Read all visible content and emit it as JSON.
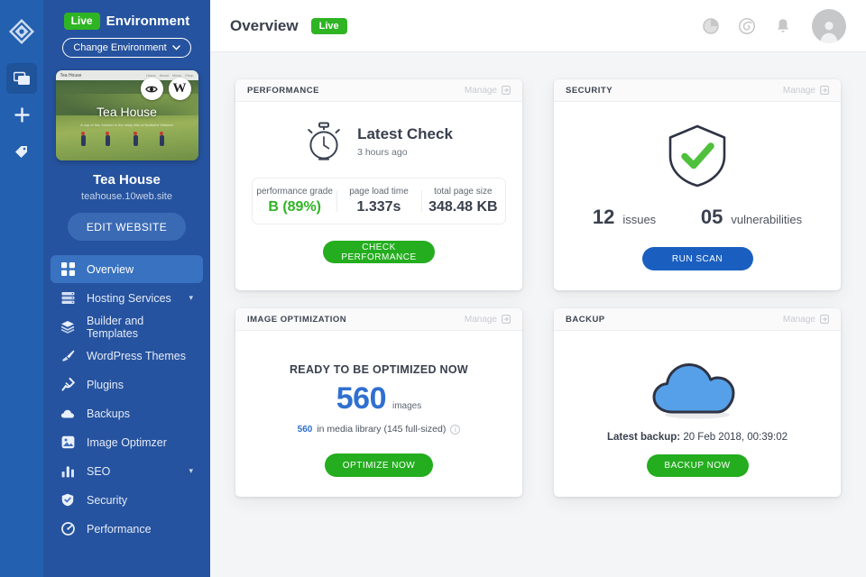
{
  "rail": {
    "logo": "diamond-logo",
    "items": [
      {
        "name": "websites-icon",
        "active": true
      },
      {
        "name": "add-icon",
        "active": false
      },
      {
        "name": "tag-icon",
        "active": false
      }
    ]
  },
  "sidebar": {
    "env_badge": "Live",
    "env_label": "Environment",
    "change_env": "Change Environment",
    "thumbnail": {
      "site_label": "Tea House",
      "hero_title": "Tea House",
      "hero_sub": "A cup of tea, brewed in the misty hills of Northern Vietnam",
      "nav": [
        "Home",
        "About",
        "Menu",
        "Shop"
      ],
      "preview_icon": "eye-icon",
      "wordpress_icon": "wordpress-icon"
    },
    "site_name": "Tea House",
    "site_url": "teahouse.10web.site",
    "edit_button": "EDIT WEBSITE",
    "items": [
      {
        "label": "Overview",
        "icon": "grid-icon",
        "active": true,
        "caret": false
      },
      {
        "label": "Hosting Services",
        "icon": "server-icon",
        "active": false,
        "caret": true
      },
      {
        "label": "Builder and Templates",
        "icon": "layers-icon",
        "active": false,
        "caret": false
      },
      {
        "label": "WordPress Themes",
        "icon": "brush-icon",
        "active": false,
        "caret": false
      },
      {
        "label": "Plugins",
        "icon": "plug-icon",
        "active": false,
        "caret": false
      },
      {
        "label": "Backups",
        "icon": "cloud-icon",
        "active": false,
        "caret": false
      },
      {
        "label": "Image Optimzer",
        "icon": "image-icon",
        "active": false,
        "caret": false
      },
      {
        "label": "SEO",
        "icon": "bar-chart-icon",
        "active": false,
        "caret": true
      },
      {
        "label": "Security",
        "icon": "shield-icon",
        "active": false,
        "caret": false
      },
      {
        "label": "Performance",
        "icon": "gauge-icon",
        "active": false,
        "caret": false
      }
    ]
  },
  "topbar": {
    "title": "Overview",
    "badge": "Live",
    "icons": [
      "pie-chart-icon",
      "spiral-icon",
      "bell-icon"
    ],
    "avatar": "user-avatar"
  },
  "cards": {
    "performance": {
      "head": "PERFORMANCE",
      "manage": "Manage",
      "icon": "stopwatch-icon",
      "heading": "Latest Check",
      "subtitle": "3 hours ago",
      "metrics": [
        {
          "label": "performance grade",
          "value": "B (89%)",
          "accent": true
        },
        {
          "label": "page load time",
          "value": "1.337s",
          "accent": false
        },
        {
          "label": "total page size",
          "value": "348.48 KB",
          "accent": false
        }
      ],
      "button": "CHECK PERFORMANCE"
    },
    "security": {
      "head": "SECURITY",
      "manage": "Manage",
      "icon": "shield-check-icon",
      "stats": [
        {
          "number": "12",
          "word": "issues"
        },
        {
          "number": "05",
          "word": "vulnerabilities"
        }
      ],
      "button": "RUN SCAN"
    },
    "image_optimization": {
      "head": "IMAGE OPTIMIZATION",
      "manage": "Manage",
      "title": "READY TO BE OPTIMIZED NOW",
      "count": "560",
      "unit": "images",
      "note_count": "560",
      "note_text": "in media library (145 full-sized)",
      "info_icon": "info-icon",
      "button": "OPTIMIZE NOW"
    },
    "backup": {
      "head": "BACKUP",
      "manage": "Manage",
      "icon": "cloud-icon",
      "label": "Latest backup:",
      "timestamp": "20 Feb 2018, 00:39:02",
      "button": "BACKUP NOW"
    }
  },
  "colors": {
    "sidebar": "#26539f",
    "rail": "#2460b0",
    "accent_blue": "#1a5fc0",
    "accent_green": "#24ad1f",
    "live_green": "#2fb424",
    "count_blue": "#2f6fd0",
    "page_bg": "#f4f5f6"
  }
}
